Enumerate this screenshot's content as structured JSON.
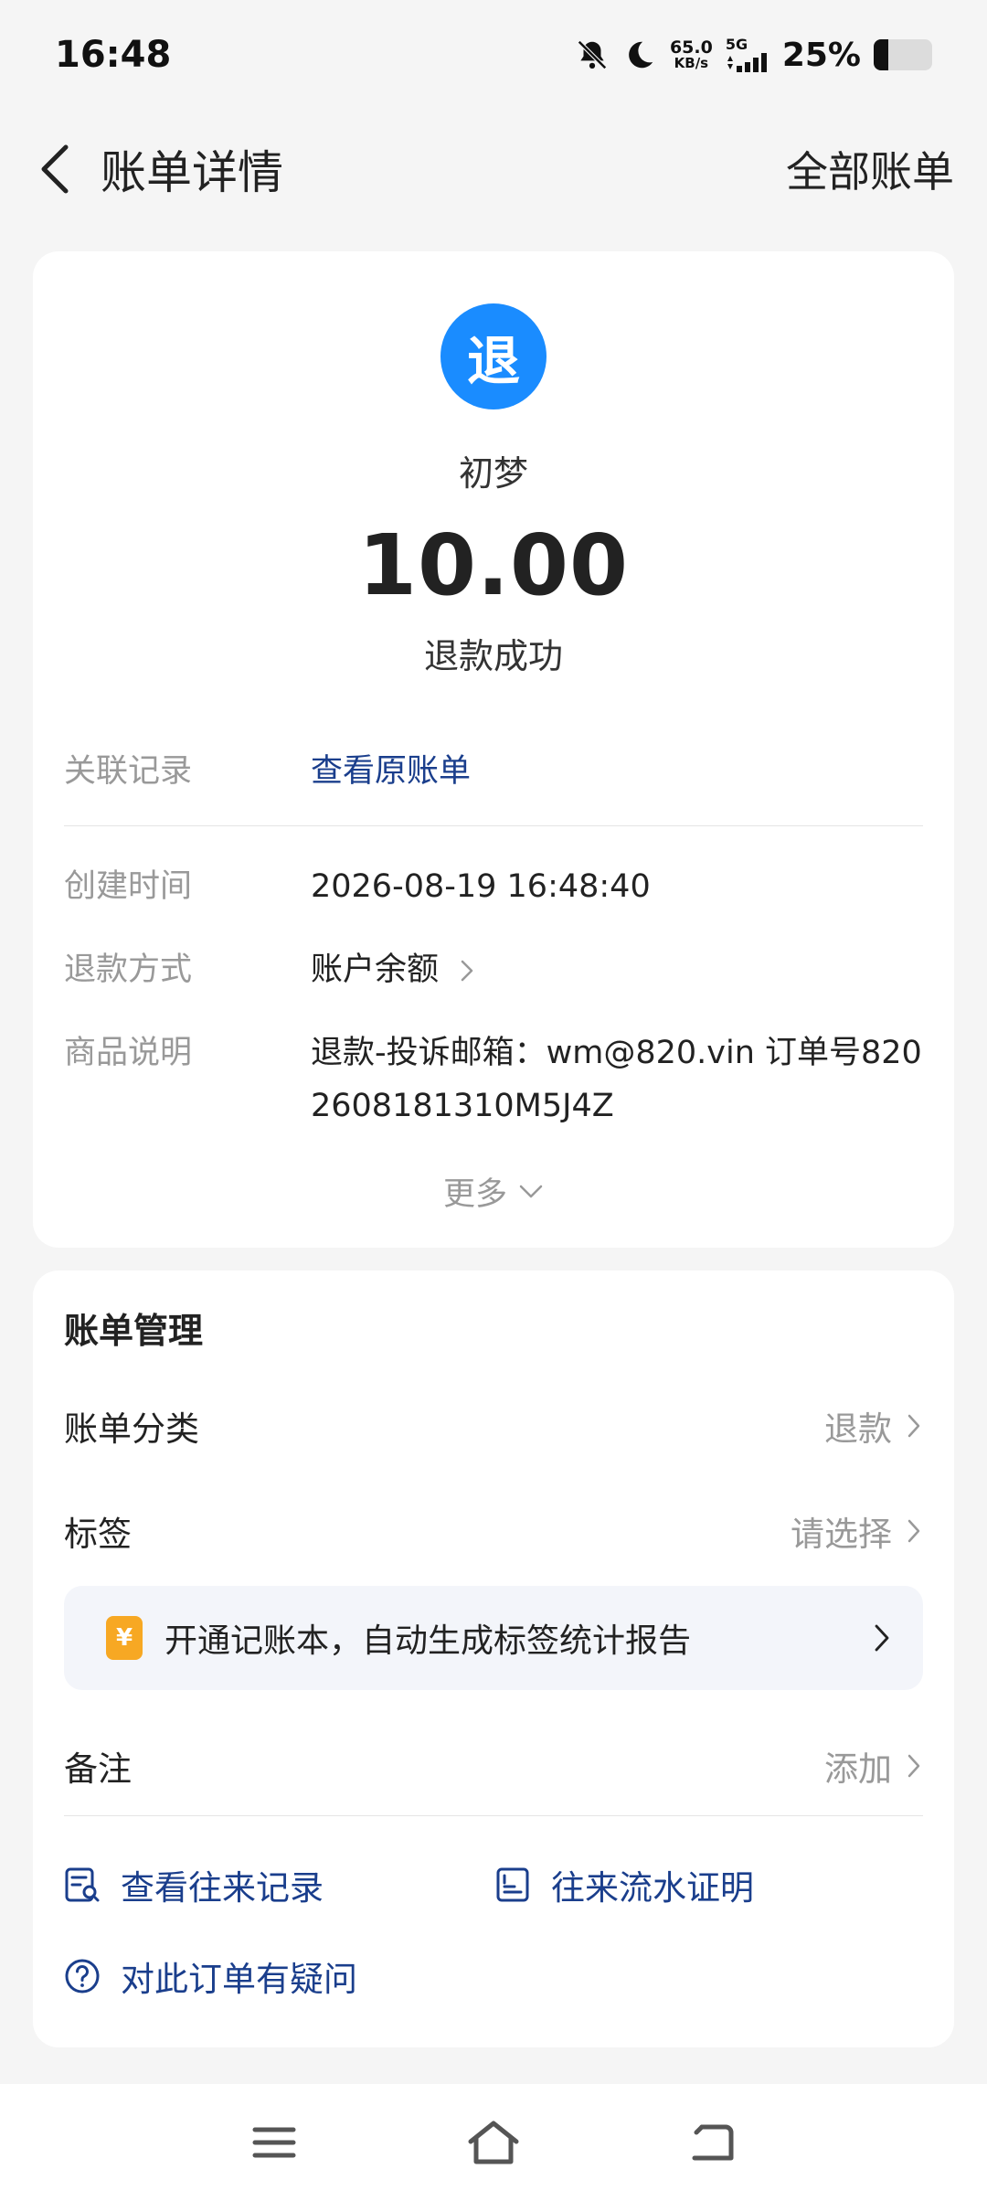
{
  "status_bar": {
    "time": "16:48",
    "net_speed_value": "65.0",
    "net_speed_unit": "KB/s",
    "network_type": "5G",
    "battery_percent": "25%",
    "battery_level": 0.25
  },
  "header": {
    "title": "账单详情",
    "right_action": "全部账单"
  },
  "transaction": {
    "badge_char": "退",
    "badge_color": "#1a8cff",
    "payee": "初梦",
    "amount": "10.00",
    "status": "退款成功"
  },
  "details": {
    "related_label": "关联记录",
    "related_value": "查看原账单",
    "created_label": "创建时间",
    "created_value": "2026-08-19 16:48:40",
    "method_label": "退款方式",
    "method_value": "账户余额",
    "desc_label": "商品说明",
    "desc_value": "退款-投诉邮箱：wm@820.vin 订单号8202608181310M5J4Z",
    "more": "更多"
  },
  "manage": {
    "title": "账单管理",
    "category_label": "账单分类",
    "category_value": "退款",
    "tag_label": "标签",
    "tag_value": "请选择",
    "promo_icon": "¥",
    "promo_text": "开通记账本，自动生成标签统计报告",
    "note_label": "备注",
    "note_value": "添加",
    "history_action": "查看往来记录",
    "proof_action": "往来流水证明",
    "question_action": "对此订单有疑问",
    "link_color": "#1a3e8c"
  },
  "nav": {
    "icons": [
      "menu-icon",
      "home-icon",
      "back-icon"
    ]
  }
}
